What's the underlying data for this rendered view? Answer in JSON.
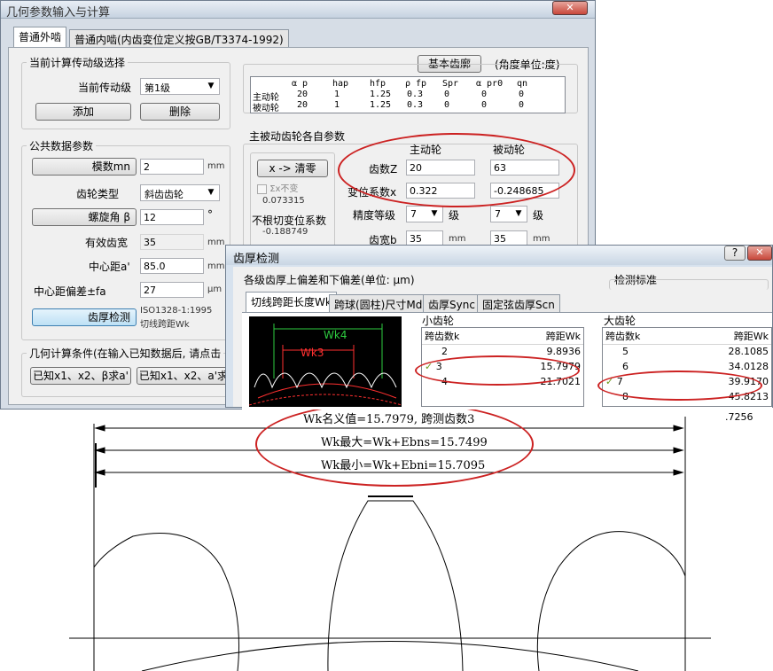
{
  "main_window": {
    "title": "几何参数输入与计算",
    "close": "✕",
    "tabs": [
      "普通外啮",
      "普通内啮(内齿变位定义按GB/T3374-1992)"
    ],
    "drive_stage": {
      "group_label": "当前计算传动级选择",
      "current_label": "当前传动级",
      "current_value": "第1级",
      "add_button": "添加",
      "delete_button": "删除"
    },
    "basic_rack": {
      "button": "基本齿廓",
      "unit_note": "(角度单位:度)",
      "headers": [
        "α p",
        "hap",
        "hfp",
        "ρ fp",
        "Spr",
        "α pr0",
        "qn"
      ],
      "rows": [
        {
          "name": "主动轮",
          "values": [
            "20",
            "1",
            "1.25",
            "0.3",
            "0",
            "0",
            "0"
          ]
        },
        {
          "name": "被动轮",
          "values": [
            "20",
            "1",
            "1.25",
            "0.3",
            "0",
            "0",
            "0"
          ]
        }
      ]
    },
    "common": {
      "group_label": "公共数据参数",
      "module_label": "模数mn",
      "module_value": "2",
      "module_unit": "mm",
      "gear_type_label": "齿轮类型",
      "gear_type_value": "斜齿齿轮",
      "helix_label": "螺旋角 β",
      "helix_value": "12",
      "helix_unit": "°",
      "face_width_label": "有效齿宽",
      "face_width_value": "35",
      "face_width_unit": "mm",
      "center_label": "中心距a'",
      "center_value": "85.0",
      "center_unit": "mm",
      "center_dev_label": "中心距偏差±fa",
      "center_dev_value": "27",
      "center_dev_unit": "μm",
      "thickness_button": "齿厚检测",
      "thickness_std": "ISO1328-1:1995",
      "thickness_method": "切线跨距Wk"
    },
    "condition": {
      "label": "几何计算条件(在输入已知数据后, 请点击",
      "btn1": "已知x1、x2、β求a'",
      "btn2": "已知x1、x2、a'求"
    },
    "gears": {
      "group_label": "主被动齿轮各自参数",
      "calc_button": "x -> 清零",
      "sum_x_label": "Σx不变",
      "sum_x_value": "0.073315",
      "undercut_label": "不根切变位系数",
      "undercut_value": "-0.188749",
      "driver_header": "主动轮",
      "driven_header": "被动轮",
      "teeth_label": "齿数Z",
      "teeth_driver": "20",
      "teeth_driven": "63",
      "shift_label": "变位系数x",
      "shift_driver": "0.322",
      "shift_driven": "-0.248685",
      "grade_label": "精度等级",
      "grade_driver": "7",
      "grade_driven": "7",
      "grade_unit": "级",
      "width_label": "齿宽b",
      "width_driver": "35",
      "width_driven": "35",
      "width_unit": "mm"
    }
  },
  "thickness_window": {
    "title": "齿厚检测",
    "help": "?",
    "close": "✕",
    "deviation_label": "各级齿厚上偏差和下偏差(单位: μm)",
    "standard_label": "检测标准",
    "tabs": [
      "切线跨距长度Wk",
      "跨球(圆柱)尺寸Md",
      "齿厚Sync",
      "固定弦齿厚Scn"
    ],
    "drawing_labels": {
      "wk4": "Wk4",
      "wk3": "Wk3"
    },
    "small_gear": {
      "label": "小齿轮",
      "col_k": "跨齿数k",
      "col_w": "跨距Wk",
      "rows": [
        {
          "k": "2",
          "w": "9.8936",
          "checked": false
        },
        {
          "k": "3",
          "w": "15.7979",
          "checked": true
        },
        {
          "k": "4",
          "w": "21.7021",
          "checked": false
        }
      ]
    },
    "large_gear": {
      "label": "大齿轮",
      "col_k": "跨齿数k",
      "col_w": "跨距Wk",
      "rows": [
        {
          "k": "5",
          "w": "28.1085",
          "checked": false
        },
        {
          "k": "6",
          "w": "34.0128",
          "checked": false
        },
        {
          "k": "7",
          "w": "39.9170",
          "checked": true
        },
        {
          "k": "8",
          "w": "45.8213",
          "checked": false
        },
        {
          "k": "",
          "w": ".7256",
          "checked": false
        }
      ]
    }
  },
  "cad": {
    "nominal": "Wk名义值=15.7979, 跨测齿数3",
    "max": "Wk最大=Wk+Ebns=15.7499",
    "min": "Wk最小=Wk+Ebni=15.7095"
  },
  "colors": {
    "annotation_ring": "#cc2222",
    "check": "#6a9a1b",
    "drawing_bg": "#000000"
  }
}
